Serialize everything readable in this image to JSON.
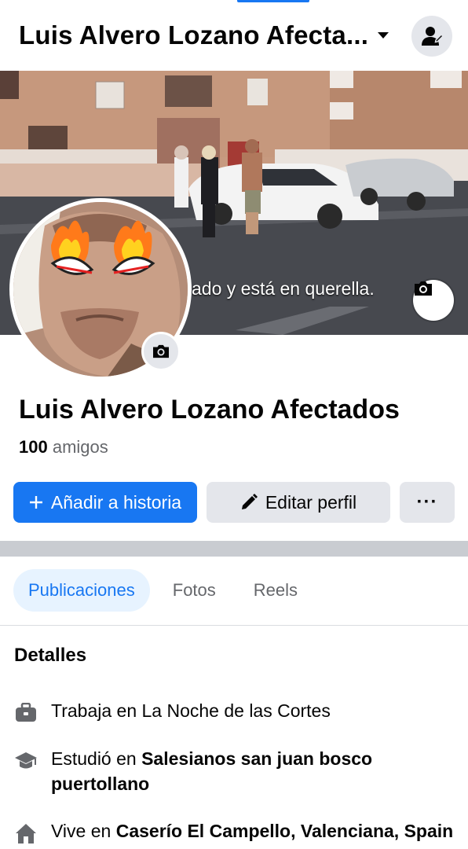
{
  "header": {
    "title": "Luis Alvero Lozano Afecta...",
    "user_icon": "user-switch-icon"
  },
  "cover": {
    "caption": "ado y está en querella.",
    "camera_icon": "camera-icon"
  },
  "profile": {
    "name": "Luis Alvero Lozano Afectados",
    "friends_count": "100",
    "friends_label": "amigos"
  },
  "actions": {
    "add_story": "Añadir a historia",
    "edit_profile": "Editar perfil",
    "more": "···"
  },
  "tabs": [
    {
      "label": "Publicaciones",
      "active": true
    },
    {
      "label": "Fotos",
      "active": false
    },
    {
      "label": "Reels",
      "active": false
    }
  ],
  "details": {
    "title": "Detalles",
    "items": [
      {
        "icon": "briefcase-icon",
        "prefix": "Trabaja en La Noche de las Cortes",
        "bold": ""
      },
      {
        "icon": "graduation-cap-icon",
        "prefix": "Estudió en ",
        "bold": "Salesianos san juan bosco puertollano"
      },
      {
        "icon": "home-icon",
        "prefix": "Vive en ",
        "bold": "Caserío El Campello, Valenciana, Spain"
      }
    ]
  },
  "colors": {
    "accent": "#1877f2",
    "secondary_button": "#e4e6eb",
    "active_tab_bg": "#e7f3ff",
    "muted_text": "#65676b"
  }
}
